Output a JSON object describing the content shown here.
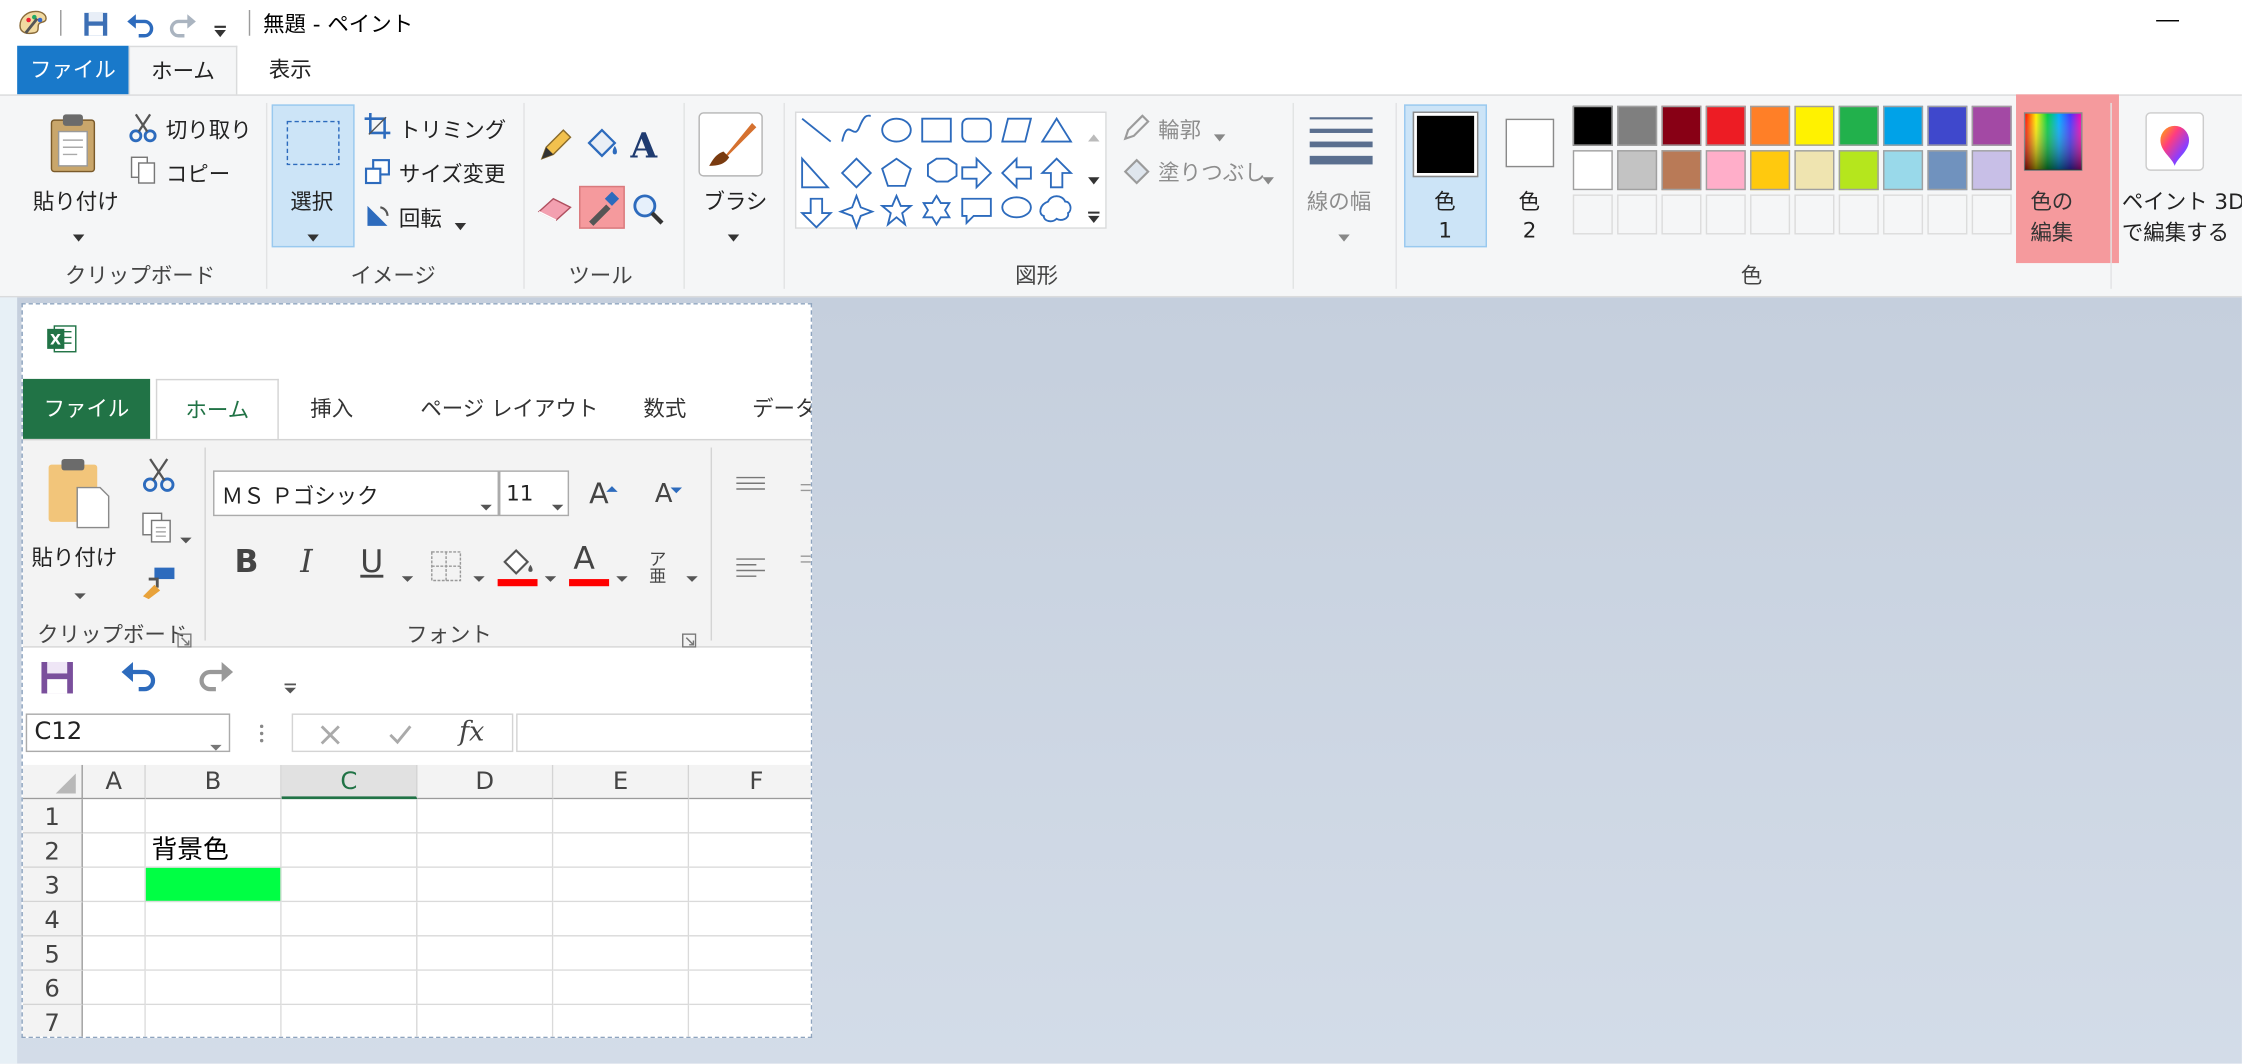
{
  "window": {
    "title": "無題 - ペイント"
  },
  "tabs": {
    "file": "ファイル",
    "home": "ホーム",
    "view": "表示"
  },
  "ribbon": {
    "clipboard": {
      "paste": "貼り付け",
      "cut": "切り取り",
      "copy": "コピー",
      "group": "クリップボード"
    },
    "image": {
      "select": "選択",
      "crop": "トリミング",
      "resize": "サイズ変更",
      "rotate": "回転",
      "group": "イメージ"
    },
    "tools": {
      "group": "ツール"
    },
    "brush": {
      "label": "ブラシ"
    },
    "shapes": {
      "outline": "輪郭",
      "fill": "塗りつぶし",
      "group": "図形"
    },
    "size": {
      "label": "線の幅"
    },
    "colors": {
      "color1_line1": "色",
      "color1_line2": "1",
      "color2_line1": "色",
      "color2_line2": "2",
      "edit_line1": "色の",
      "edit_line2": "編集",
      "paint3d_line1": "ペイント 3D",
      "paint3d_line2": "で編集する",
      "group": "色",
      "row1": [
        "#000000",
        "#7f7f7f",
        "#880015",
        "#ed1c24",
        "#ff7f27",
        "#fff200",
        "#22b14c",
        "#00a2e8",
        "#3f48cc",
        "#a349a4"
      ],
      "row2": [
        "#ffffff",
        "#c3c3c3",
        "#b97a57",
        "#ffaec9",
        "#ffc90e",
        "#efe4b0",
        "#b5e61d",
        "#99d9ea",
        "#7092be",
        "#c8bfe7"
      ]
    }
  },
  "excel": {
    "tabs": {
      "file": "ファイル",
      "home": "ホーム",
      "insert": "挿入",
      "layout": "ページ レイアウト",
      "formulas": "数式",
      "data": "データ"
    },
    "ribbon": {
      "paste": "貼り付け",
      "clipboard_group": "クリップボード",
      "font_name": "ＭＳ Ｐゴシック",
      "font_size": "11",
      "font_group": "フォント",
      "bold": "B",
      "italic": "I",
      "underline": "U",
      "grow": "A",
      "shrink": "A",
      "font_color": "A",
      "phonetic": "ア亜"
    },
    "name_box": "C12",
    "fx": "fx",
    "columns": [
      "A",
      "B",
      "C",
      "D",
      "E",
      "F"
    ],
    "rows": [
      "1",
      "2",
      "3",
      "4",
      "5",
      "6",
      "7"
    ],
    "cell_B2": "背景色",
    "cell_B3_color": "#00ff44"
  }
}
